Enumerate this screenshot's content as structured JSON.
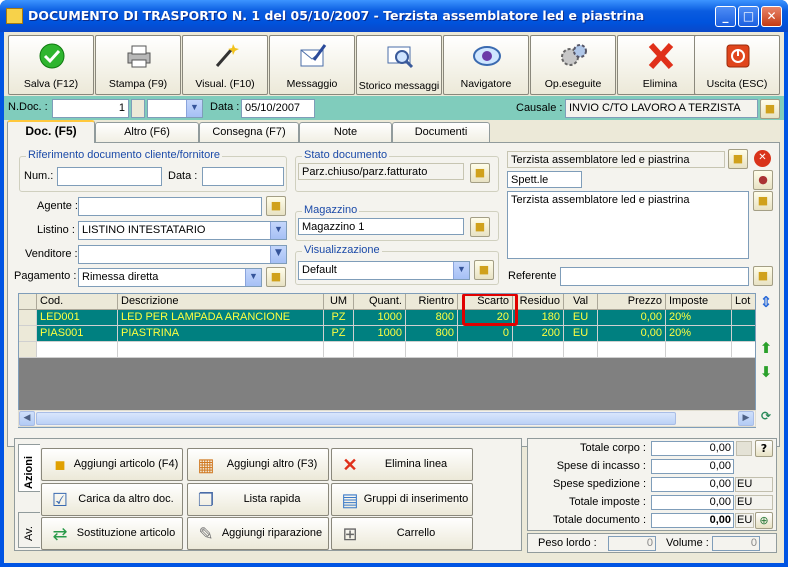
{
  "window": {
    "title": "DOCUMENTO DI TRASPORTO N. 1   del 05/10/2007 - Terzista assemblatore led e piastrina"
  },
  "toolbar": [
    {
      "label": "Salva (F12)",
      "icon": "check-icon"
    },
    {
      "label": "Stampa (F9)",
      "icon": "printer-icon"
    },
    {
      "label": "Visual. (F10)",
      "icon": "magic-wand-icon"
    },
    {
      "label": "Messaggio",
      "icon": "message-icon"
    },
    {
      "label": "Storico messaggi",
      "icon": "message-history-icon"
    },
    {
      "label": "Navigatore",
      "icon": "navigator-icon"
    },
    {
      "label": "Op.eseguite",
      "icon": "gears-icon"
    },
    {
      "label": "Elimina",
      "icon": "delete-icon"
    },
    {
      "label": "Uscita (ESC)",
      "icon": "exit-icon"
    }
  ],
  "header": {
    "ndoc_label": "N.Doc. :",
    "ndoc_value": "1",
    "data_label": "Data :",
    "data_value": "05/10/2007",
    "causale_label": "Causale :",
    "causale_value": "INVIO C/TO LAVORO A TERZISTA"
  },
  "tabs": [
    "Doc. (F5)",
    "Altro (F6)",
    "Consegna (F7)",
    "Note",
    "Documenti"
  ],
  "form": {
    "rif_title": "Riferimento documento cliente/fornitore",
    "num_label": "Num.:",
    "num_value": "",
    "data_label": "Data :",
    "data_value": "",
    "agente_label": "Agente :",
    "agente_value": "",
    "listino_label": "Listino :",
    "listino_value": "LISTINO INTESTATARIO",
    "venditore_label": "Venditore :",
    "venditore_value": "",
    "pagamento_label": "Pagamento :",
    "pagamento_value": "Rimessa diretta",
    "stato_title": "Stato documento",
    "stato_value": "Parz.chiuso/parz.fatturato",
    "magazzino_title": "Magazzino",
    "magazzino_value": "Magazzino 1",
    "visual_title": "Visualizzazione",
    "visual_value": "Default",
    "intest_name": "Terzista assemblatore led e piastrina",
    "spett": "Spett.le",
    "address": "Terzista assemblatore led e piastrina",
    "referente_label": "Referente",
    "referente_value": ""
  },
  "grid": {
    "columns": [
      "Cod.",
      "Descrizione",
      "UM",
      "Quant.",
      "Rientro",
      "Scarto",
      "Residuo",
      "Val",
      "Prezzo",
      "Imposte",
      "Lot"
    ],
    "rows": [
      [
        "LED001",
        "LED PER LAMPADA ARANCIONE",
        "PZ",
        "1000",
        "800",
        "20",
        "180",
        "EU",
        "0,00",
        "20%",
        ""
      ],
      [
        "PIAS001",
        "PIASTRINA",
        "PZ",
        "1000",
        "800",
        "0",
        "200",
        "EU",
        "0,00",
        "20%",
        ""
      ]
    ],
    "highlight_column": "Scarto",
    "highlight_color": "#e00000",
    "selected_row_color": "#008080",
    "selected_text_color": "#ffff40"
  },
  "actions": {
    "tab_azioni": "Azioni",
    "tab_av": "Av.",
    "buttons": [
      {
        "label": "Aggiungi articolo (F4)",
        "icon": "add-article-icon"
      },
      {
        "label": "Aggiungi altro (F3)",
        "icon": "add-other-icon"
      },
      {
        "label": "Elimina linea",
        "icon": "delete-line-icon"
      },
      {
        "label": "Carica da altro doc.",
        "icon": "load-doc-icon"
      },
      {
        "label": "Lista rapida",
        "icon": "quick-list-icon"
      },
      {
        "label": "Gruppi di inserimento",
        "icon": "insert-groups-icon"
      },
      {
        "label": "Sostituzione articolo",
        "icon": "replace-article-icon"
      },
      {
        "label": "Aggiungi riparazione",
        "icon": "repair-icon"
      },
      {
        "label": "Carrello",
        "icon": "cart-icon"
      }
    ]
  },
  "totals": {
    "rows": [
      {
        "label": "Totale corpo :",
        "value": "0,00",
        "cur": ""
      },
      {
        "label": "Spese di incasso :",
        "value": "0,00",
        "cur": ""
      },
      {
        "label": "Spese spedizione :",
        "value": "0,00",
        "cur": "EU"
      },
      {
        "label": "Totale imposte :",
        "value": "0,00",
        "cur": "EU"
      },
      {
        "label": "Totale documento :",
        "value": "0,00",
        "cur": "EU"
      }
    ],
    "help": "?",
    "peso_label": "Peso lordo :",
    "peso_value": "0",
    "volume_label": "Volume :",
    "volume_value": "0"
  }
}
